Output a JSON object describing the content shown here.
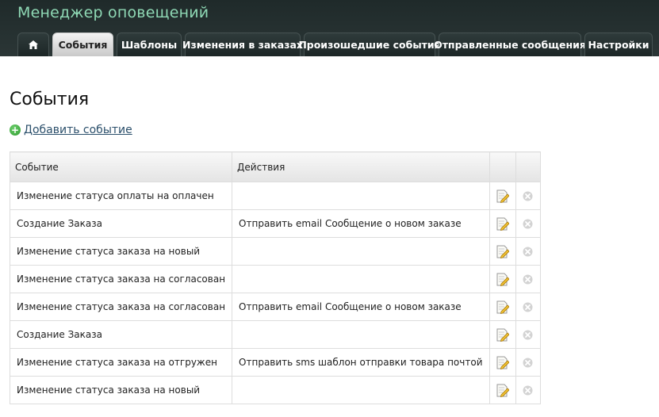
{
  "app": {
    "title": "Менеджер оповещений"
  },
  "colors": {
    "header_bg": "#243030",
    "title": "#8fd9b5",
    "link": "#2b4f6b",
    "add_icon": "#2d9a2d"
  },
  "nav": {
    "home_icon": "home-icon",
    "tabs": [
      {
        "label": "События",
        "active": true
      },
      {
        "label": "Шаблоны"
      },
      {
        "label": "Изменения в заказах"
      },
      {
        "label": "Произошедшие события"
      },
      {
        "label": "Отправленные сообщения"
      },
      {
        "label": "Настройки"
      }
    ]
  },
  "page": {
    "title": "События",
    "add_event_label": "Добавить событие",
    "add_icon": "plus-circle-icon"
  },
  "table": {
    "columns": [
      "Событие",
      "Действия",
      "",
      ""
    ],
    "row_icons": {
      "edit": "edit-icon",
      "delete": "delete-icon"
    },
    "rows": [
      {
        "event": "Изменение статуса оплаты на оплачен",
        "action": ""
      },
      {
        "event": "Создание Заказа",
        "action": "Отправить email Сообщение о новом заказе"
      },
      {
        "event": "Изменение статуса заказа на новый",
        "action": ""
      },
      {
        "event": "Изменение статуса заказа на согласован",
        "action": ""
      },
      {
        "event": "Изменение статуса заказа на согласован",
        "action": "Отправить email Сообщение о новом заказе"
      },
      {
        "event": "Создание Заказа",
        "action": ""
      },
      {
        "event": "Изменение статуса заказа на отгружен",
        "action": "Отправить sms шаблон отправки товара почтой"
      },
      {
        "event": "Изменение статуса заказа на новый",
        "action": ""
      }
    ]
  }
}
